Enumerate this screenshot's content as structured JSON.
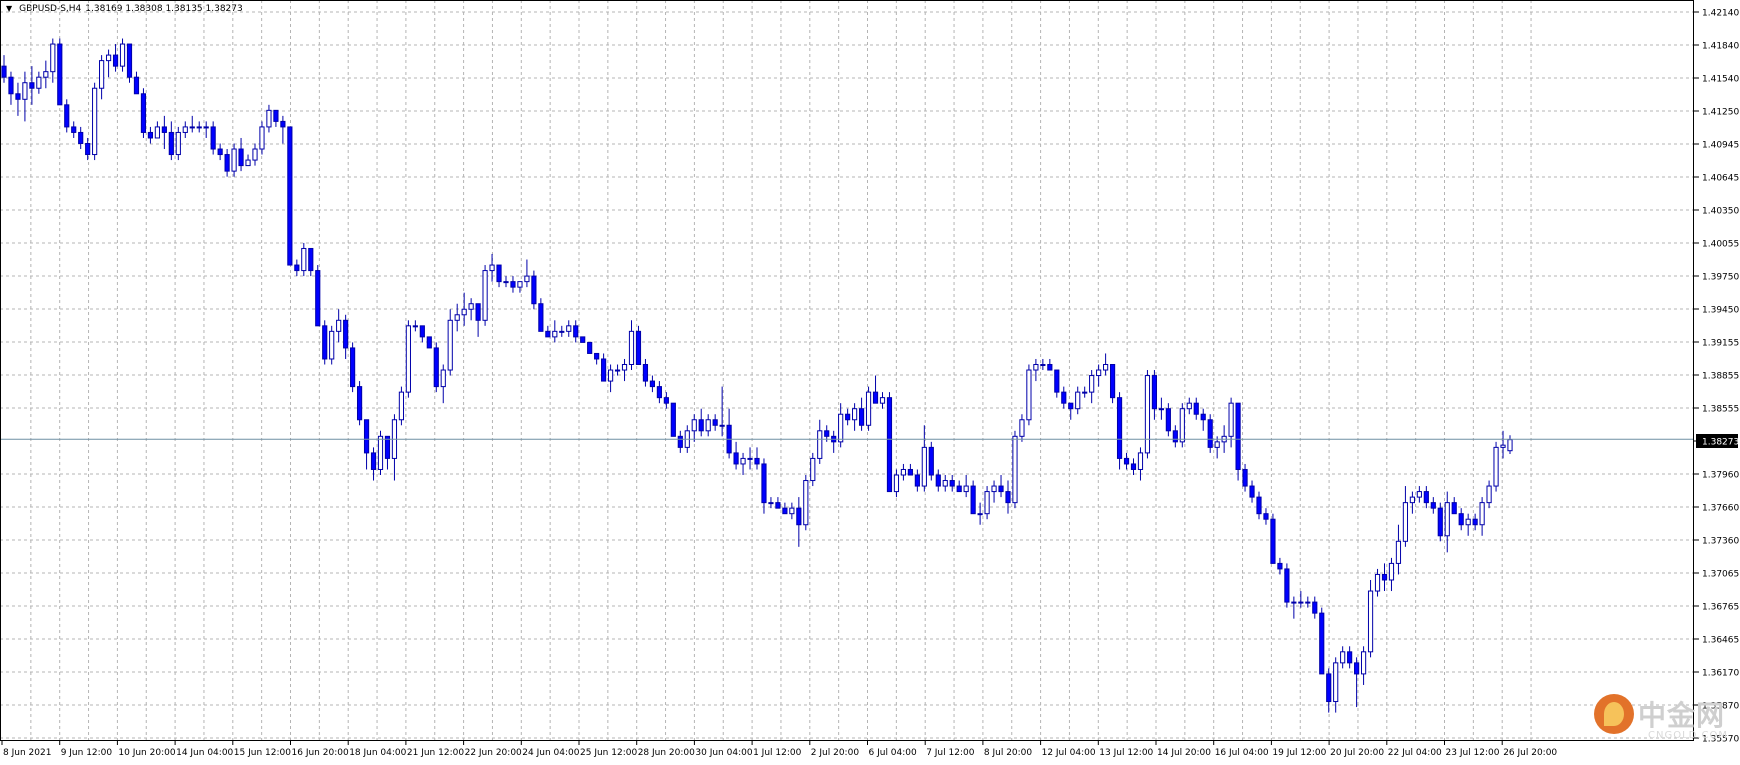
{
  "header": {
    "symbol": "GBPUSD-S,H4",
    "ohlc": "1.38169 1.38308 1.38135 1.38273"
  },
  "price_axis": {
    "labels": [
      "1.42140",
      "1.41840",
      "1.41540",
      "1.41250",
      "1.40945",
      "1.40645",
      "1.40350",
      "1.40055",
      "1.39750",
      "1.39450",
      "1.39155",
      "1.38855",
      "1.38555",
      "1.38273",
      "1.37960",
      "1.37660",
      "1.37360",
      "1.37065",
      "1.36765",
      "1.36465",
      "1.36170",
      "1.35870",
      "1.35570"
    ],
    "current_price": "1.38273"
  },
  "time_axis": {
    "labels": [
      "8 Jun 2021",
      "9 Jun 12:00",
      "10 Jun 20:00",
      "14 Jun 04:00",
      "15 Jun 12:00",
      "16 Jun 20:00",
      "18 Jun 04:00",
      "21 Jun 12:00",
      "22 Jun 20:00",
      "24 Jun 04:00",
      "25 Jun 12:00",
      "28 Jun 20:00",
      "30 Jun 04:00",
      "1 Jul 12:00",
      "2 Jul 20:00",
      "6 Jul 04:00",
      "7 Jul 12:00",
      "8 Jul 20:00",
      "12 Jul 04:00",
      "13 Jul 12:00",
      "14 Jul 20:00",
      "16 Jul 04:00",
      "19 Jul 12:00",
      "20 Jul 20:00",
      "22 Jul 04:00",
      "23 Jul 12:00",
      "26 Jul 20:00"
    ]
  },
  "watermark": {
    "logo_text": "中金网",
    "logo_sub": "CNGOLD.COM"
  },
  "colors": {
    "bull": "#ffffff",
    "bear": "#0000ff",
    "wick": "#0000aa",
    "grid": "#b4b4b4",
    "current_line": "#6f8fa3",
    "price_box": "#000000"
  },
  "chart_data": {
    "type": "candlestick",
    "title": "",
    "timeframe": "H4",
    "ylim": [
      1.3557,
      1.4214
    ],
    "ohlc": [
      [
        1.4165,
        1.4175,
        1.415,
        1.4155
      ],
      [
        1.4155,
        1.416,
        1.413,
        1.414
      ],
      [
        1.414,
        1.415,
        1.412,
        1.4135
      ],
      [
        1.4135,
        1.416,
        1.4115,
        1.415
      ],
      [
        1.415,
        1.4165,
        1.413,
        1.4145
      ],
      [
        1.4145,
        1.416,
        1.414,
        1.4155
      ],
      [
        1.4155,
        1.417,
        1.4145,
        1.416
      ],
      [
        1.416,
        1.419,
        1.415,
        1.4185
      ],
      [
        1.4185,
        1.419,
        1.413,
        1.413
      ],
      [
        1.413,
        1.4135,
        1.4105,
        1.411
      ],
      [
        1.411,
        1.4115,
        1.41,
        1.4105
      ],
      [
        1.4105,
        1.411,
        1.409,
        1.4095
      ],
      [
        1.4095,
        1.41,
        1.408,
        1.4085
      ],
      [
        1.4085,
        1.415,
        1.408,
        1.4145
      ],
      [
        1.4145,
        1.4175,
        1.4135,
        1.417
      ],
      [
        1.417,
        1.418,
        1.4155,
        1.4175
      ],
      [
        1.4175,
        1.4185,
        1.416,
        1.4165
      ],
      [
        1.4165,
        1.419,
        1.416,
        1.4185
      ],
      [
        1.4185,
        1.418,
        1.415,
        1.4155
      ],
      [
        1.4155,
        1.416,
        1.414,
        1.414
      ],
      [
        1.414,
        1.4145,
        1.41,
        1.4105
      ],
      [
        1.4105,
        1.411,
        1.4095,
        1.41
      ],
      [
        1.41,
        1.4115,
        1.41,
        1.411
      ],
      [
        1.411,
        1.412,
        1.409,
        1.4105
      ],
      [
        1.4105,
        1.4115,
        1.408,
        1.4085
      ],
      [
        1.4085,
        1.411,
        1.408,
        1.4105
      ],
      [
        1.4105,
        1.4115,
        1.41,
        1.411
      ],
      [
        1.411,
        1.412,
        1.4105,
        1.411
      ],
      [
        1.411,
        1.4115,
        1.4105,
        1.411
      ],
      [
        1.411,
        1.4115,
        1.41,
        1.411
      ],
      [
        1.411,
        1.4115,
        1.4085,
        1.409
      ],
      [
        1.409,
        1.4095,
        1.408,
        1.4085
      ],
      [
        1.4085,
        1.409,
        1.4065,
        1.407
      ],
      [
        1.407,
        1.4095,
        1.4065,
        1.409
      ],
      [
        1.409,
        1.41,
        1.407,
        1.4075
      ],
      [
        1.4075,
        1.4085,
        1.4075,
        1.408
      ],
      [
        1.408,
        1.4095,
        1.4075,
        1.409
      ],
      [
        1.409,
        1.4115,
        1.4085,
        1.411
      ],
      [
        1.411,
        1.413,
        1.4105,
        1.4125
      ],
      [
        1.4125,
        1.4125,
        1.411,
        1.4115
      ],
      [
        1.4115,
        1.412,
        1.4095,
        1.411
      ],
      [
        1.411,
        1.411,
        1.3985,
        1.3985
      ],
      [
        1.3985,
        1.399,
        1.3975,
        1.398
      ],
      [
        1.398,
        1.4005,
        1.3975,
        1.4
      ],
      [
        1.4,
        1.4,
        1.3975,
        1.398
      ],
      [
        1.398,
        1.3985,
        1.393,
        1.393
      ],
      [
        1.393,
        1.3935,
        1.3895,
        1.39
      ],
      [
        1.39,
        1.393,
        1.3895,
        1.3925
      ],
      [
        1.3925,
        1.3945,
        1.3915,
        1.3935
      ],
      [
        1.3935,
        1.394,
        1.39,
        1.391
      ],
      [
        1.391,
        1.3915,
        1.387,
        1.3875
      ],
      [
        1.3875,
        1.388,
        1.384,
        1.3845
      ],
      [
        1.3845,
        1.3845,
        1.38,
        1.3815
      ],
      [
        1.3815,
        1.382,
        1.379,
        1.38
      ],
      [
        1.38,
        1.3835,
        1.3795,
        1.383
      ],
      [
        1.383,
        1.383,
        1.38,
        1.381
      ],
      [
        1.381,
        1.385,
        1.379,
        1.3845
      ],
      [
        1.3845,
        1.3875,
        1.384,
        1.387
      ],
      [
        1.387,
        1.3935,
        1.3865,
        1.393
      ],
      [
        1.393,
        1.3935,
        1.3925,
        1.393
      ],
      [
        1.393,
        1.3925,
        1.3915,
        1.392
      ],
      [
        1.392,
        1.392,
        1.391,
        1.391
      ],
      [
        1.391,
        1.3915,
        1.387,
        1.3875
      ],
      [
        1.3875,
        1.3895,
        1.386,
        1.389
      ],
      [
        1.389,
        1.3945,
        1.3885,
        1.3935
      ],
      [
        1.3935,
        1.395,
        1.3925,
        1.394
      ],
      [
        1.394,
        1.396,
        1.393,
        1.3945
      ],
      [
        1.3945,
        1.3955,
        1.3935,
        1.395
      ],
      [
        1.395,
        1.395,
        1.392,
        1.3935
      ],
      [
        1.3935,
        1.3985,
        1.393,
        1.398
      ],
      [
        1.398,
        1.3995,
        1.397,
        1.3985
      ],
      [
        1.3985,
        1.398,
        1.3965,
        1.397
      ],
      [
        1.397,
        1.3975,
        1.3965,
        1.397
      ],
      [
        1.397,
        1.3975,
        1.396,
        1.3965
      ],
      [
        1.3965,
        1.397,
        1.396,
        1.397
      ],
      [
        1.397,
        1.399,
        1.3965,
        1.3975
      ],
      [
        1.3975,
        1.398,
        1.3945,
        1.395
      ],
      [
        1.395,
        1.3955,
        1.3925,
        1.3925
      ],
      [
        1.3925,
        1.393,
        1.392,
        1.392
      ],
      [
        1.392,
        1.3935,
        1.3915,
        1.3925
      ],
      [
        1.3925,
        1.393,
        1.392,
        1.3925
      ],
      [
        1.3925,
        1.3935,
        1.392,
        1.393
      ],
      [
        1.393,
        1.3935,
        1.3915,
        1.392
      ],
      [
        1.392,
        1.392,
        1.3915,
        1.3915
      ],
      [
        1.3915,
        1.3915,
        1.3905,
        1.3905
      ],
      [
        1.3905,
        1.3905,
        1.3895,
        1.39
      ],
      [
        1.39,
        1.3905,
        1.388,
        1.388
      ],
      [
        1.388,
        1.3895,
        1.387,
        1.389
      ],
      [
        1.389,
        1.3895,
        1.3885,
        1.389
      ],
      [
        1.389,
        1.39,
        1.388,
        1.3895
      ],
      [
        1.3895,
        1.3935,
        1.389,
        1.3925
      ],
      [
        1.3925,
        1.393,
        1.3895,
        1.3895
      ],
      [
        1.3895,
        1.39,
        1.3875,
        1.388
      ],
      [
        1.388,
        1.3885,
        1.387,
        1.3875
      ],
      [
        1.3875,
        1.388,
        1.386,
        1.3865
      ],
      [
        1.3865,
        1.387,
        1.3855,
        1.386
      ],
      [
        1.386,
        1.386,
        1.383,
        1.383
      ],
      [
        1.383,
        1.3835,
        1.3815,
        1.382
      ],
      [
        1.382,
        1.384,
        1.3815,
        1.3835
      ],
      [
        1.3835,
        1.385,
        1.3825,
        1.3845
      ],
      [
        1.3845,
        1.3855,
        1.383,
        1.3835
      ],
      [
        1.3835,
        1.385,
        1.383,
        1.3845
      ],
      [
        1.3845,
        1.385,
        1.3835,
        1.384
      ],
      [
        1.384,
        1.3875,
        1.383,
        1.384
      ],
      [
        1.384,
        1.3855,
        1.381,
        1.3815
      ],
      [
        1.3815,
        1.3825,
        1.38,
        1.3805
      ],
      [
        1.3805,
        1.3815,
        1.3795,
        1.381
      ],
      [
        1.381,
        1.382,
        1.38,
        1.381
      ],
      [
        1.381,
        1.382,
        1.38,
        1.3805
      ],
      [
        1.3805,
        1.381,
        1.376,
        1.377
      ],
      [
        1.377,
        1.3775,
        1.3765,
        1.377
      ],
      [
        1.377,
        1.3775,
        1.3765,
        1.3765
      ],
      [
        1.3765,
        1.377,
        1.376,
        1.376
      ],
      [
        1.376,
        1.377,
        1.3755,
        1.3765
      ],
      [
        1.3765,
        1.3775,
        1.373,
        1.375
      ],
      [
        1.375,
        1.3795,
        1.3745,
        1.379
      ],
      [
        1.379,
        1.3815,
        1.3785,
        1.381
      ],
      [
        1.381,
        1.3845,
        1.3805,
        1.3835
      ],
      [
        1.3835,
        1.384,
        1.3825,
        1.383
      ],
      [
        1.383,
        1.3835,
        1.3815,
        1.3825
      ],
      [
        1.3825,
        1.386,
        1.382,
        1.385
      ],
      [
        1.385,
        1.3855,
        1.384,
        1.3845
      ],
      [
        1.3845,
        1.386,
        1.3835,
        1.3855
      ],
      [
        1.3855,
        1.3865,
        1.3835,
        1.384
      ],
      [
        1.384,
        1.3875,
        1.3835,
        1.387
      ],
      [
        1.387,
        1.3885,
        1.386,
        1.386
      ],
      [
        1.386,
        1.387,
        1.3855,
        1.3865
      ],
      [
        1.3865,
        1.387,
        1.378,
        1.378
      ],
      [
        1.378,
        1.38,
        1.3775,
        1.3795
      ],
      [
        1.3795,
        1.3805,
        1.379,
        1.38
      ],
      [
        1.38,
        1.3805,
        1.3795,
        1.3795
      ],
      [
        1.3795,
        1.38,
        1.378,
        1.3785
      ],
      [
        1.3785,
        1.384,
        1.378,
        1.382
      ],
      [
        1.382,
        1.3825,
        1.379,
        1.3795
      ],
      [
        1.3795,
        1.38,
        1.378,
        1.3785
      ],
      [
        1.3785,
        1.3795,
        1.378,
        1.379
      ],
      [
        1.379,
        1.3795,
        1.378,
        1.3785
      ],
      [
        1.3785,
        1.379,
        1.378,
        1.378
      ],
      [
        1.378,
        1.3795,
        1.3775,
        1.3785
      ],
      [
        1.3785,
        1.379,
        1.376,
        1.376
      ],
      [
        1.376,
        1.377,
        1.375,
        1.376
      ],
      [
        1.376,
        1.3785,
        1.3755,
        1.378
      ],
      [
        1.378,
        1.379,
        1.377,
        1.3785
      ],
      [
        1.3785,
        1.3795,
        1.3775,
        1.378
      ],
      [
        1.378,
        1.379,
        1.376,
        1.377
      ],
      [
        1.377,
        1.3835,
        1.3765,
        1.383
      ],
      [
        1.383,
        1.385,
        1.3825,
        1.3845
      ],
      [
        1.3845,
        1.3895,
        1.384,
        1.389
      ],
      [
        1.389,
        1.39,
        1.388,
        1.3895
      ],
      [
        1.3895,
        1.39,
        1.389,
        1.3895
      ],
      [
        1.3895,
        1.39,
        1.389,
        1.389
      ],
      [
        1.389,
        1.389,
        1.3865,
        1.387
      ],
      [
        1.387,
        1.3875,
        1.3855,
        1.386
      ],
      [
        1.386,
        1.386,
        1.3845,
        1.3855
      ],
      [
        1.3855,
        1.3875,
        1.385,
        1.387
      ],
      [
        1.387,
        1.3875,
        1.3865,
        1.387
      ],
      [
        1.387,
        1.389,
        1.386,
        1.3885
      ],
      [
        1.3885,
        1.3895,
        1.3875,
        1.389
      ],
      [
        1.389,
        1.3905,
        1.3885,
        1.3895
      ],
      [
        1.3895,
        1.3895,
        1.386,
        1.3865
      ],
      [
        1.3865,
        1.387,
        1.38,
        1.381
      ],
      [
        1.381,
        1.3815,
        1.38,
        1.3805
      ],
      [
        1.3805,
        1.381,
        1.3795,
        1.38
      ],
      [
        1.38,
        1.382,
        1.379,
        1.3815
      ],
      [
        1.3815,
        1.389,
        1.381,
        1.3885
      ],
      [
        1.3885,
        1.389,
        1.3845,
        1.3855
      ],
      [
        1.3855,
        1.3865,
        1.3845,
        1.3855
      ],
      [
        1.3855,
        1.386,
        1.383,
        1.3835
      ],
      [
        1.3835,
        1.384,
        1.382,
        1.3825
      ],
      [
        1.3825,
        1.386,
        1.382,
        1.3855
      ],
      [
        1.3855,
        1.3865,
        1.385,
        1.386
      ],
      [
        1.386,
        1.3865,
        1.3845,
        1.385
      ],
      [
        1.385,
        1.3855,
        1.3835,
        1.3845
      ],
      [
        1.3845,
        1.385,
        1.3815,
        1.382
      ],
      [
        1.382,
        1.383,
        1.381,
        1.3825
      ],
      [
        1.3825,
        1.384,
        1.3815,
        1.383
      ],
      [
        1.383,
        1.3865,
        1.382,
        1.386
      ],
      [
        1.386,
        1.386,
        1.379,
        1.38
      ],
      [
        1.38,
        1.3805,
        1.378,
        1.3785
      ],
      [
        1.3785,
        1.379,
        1.377,
        1.3775
      ],
      [
        1.3775,
        1.378,
        1.3755,
        1.376
      ],
      [
        1.376,
        1.3765,
        1.375,
        1.3755
      ],
      [
        1.3755,
        1.376,
        1.3715,
        1.3715
      ],
      [
        1.3715,
        1.372,
        1.3705,
        1.371
      ],
      [
        1.371,
        1.3715,
        1.3675,
        1.368
      ],
      [
        1.368,
        1.3685,
        1.3665,
        1.368
      ],
      [
        1.368,
        1.369,
        1.3675,
        1.368
      ],
      [
        1.368,
        1.3685,
        1.3675,
        1.368
      ],
      [
        1.368,
        1.3685,
        1.3665,
        1.367
      ],
      [
        1.367,
        1.3675,
        1.3615,
        1.3615
      ],
      [
        1.3615,
        1.362,
        1.358,
        1.359
      ],
      [
        1.359,
        1.363,
        1.358,
        1.3625
      ],
      [
        1.3625,
        1.364,
        1.362,
        1.3635
      ],
      [
        1.3635,
        1.364,
        1.362,
        1.3625
      ],
      [
        1.3625,
        1.363,
        1.3585,
        1.3615
      ],
      [
        1.3615,
        1.364,
        1.3605,
        1.3635
      ],
      [
        1.3635,
        1.37,
        1.363,
        1.369
      ],
      [
        1.369,
        1.371,
        1.3685,
        1.3705
      ],
      [
        1.3705,
        1.3715,
        1.369,
        1.37
      ],
      [
        1.37,
        1.372,
        1.369,
        1.3715
      ],
      [
        1.3715,
        1.375,
        1.3705,
        1.3735
      ],
      [
        1.3735,
        1.3785,
        1.373,
        1.377
      ],
      [
        1.377,
        1.378,
        1.376,
        1.3775
      ],
      [
        1.3775,
        1.3785,
        1.377,
        1.378
      ],
      [
        1.378,
        1.3785,
        1.3765,
        1.377
      ],
      [
        1.377,
        1.3775,
        1.376,
        1.3765
      ],
      [
        1.3765,
        1.377,
        1.3735,
        1.374
      ],
      [
        1.374,
        1.378,
        1.3725,
        1.377
      ],
      [
        1.377,
        1.3775,
        1.376,
        1.376
      ],
      [
        1.376,
        1.3765,
        1.3745,
        1.375
      ],
      [
        1.375,
        1.376,
        1.374,
        1.3755
      ],
      [
        1.3755,
        1.376,
        1.3745,
        1.375
      ],
      [
        1.375,
        1.3775,
        1.374,
        1.377
      ],
      [
        1.377,
        1.379,
        1.3765,
        1.3785
      ],
      [
        1.3785,
        1.3825,
        1.378,
        1.382
      ],
      [
        1.382,
        1.3835,
        1.381,
        1.3822
      ],
      [
        1.3817,
        1.3831,
        1.3814,
        1.3827
      ]
    ]
  }
}
